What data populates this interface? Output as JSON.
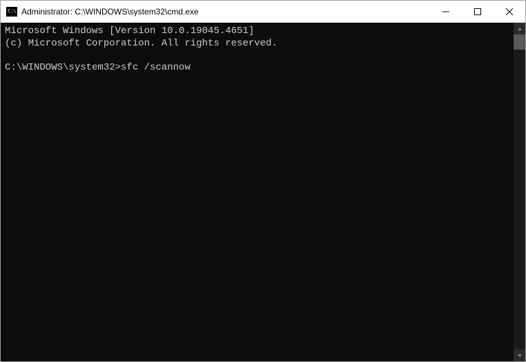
{
  "titlebar": {
    "title": "Administrator: C:\\WINDOWS\\system32\\cmd.exe"
  },
  "terminal": {
    "header_line1": "Microsoft Windows [Version 10.0.19045.4651]",
    "header_line2": "(c) Microsoft Corporation. All rights reserved.",
    "prompt": "C:\\WINDOWS\\system32>",
    "command": "sfc /scannow"
  }
}
